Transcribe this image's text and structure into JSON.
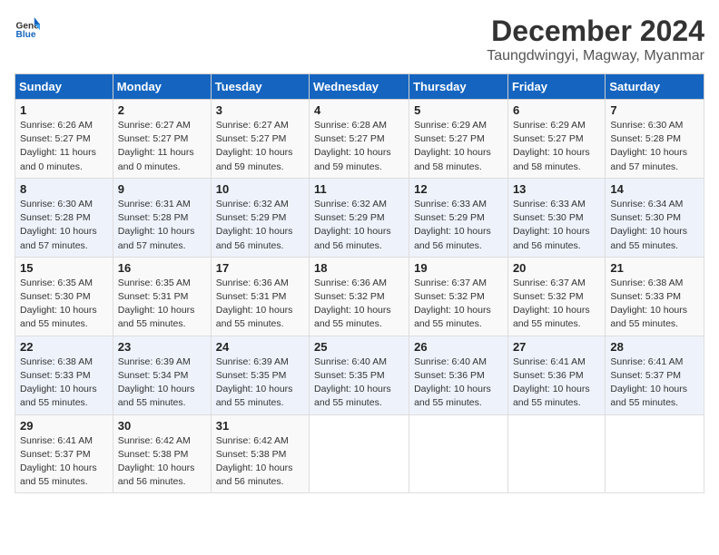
{
  "logo": {
    "general": "General",
    "blue": "Blue"
  },
  "title": "December 2024",
  "subtitle": "Taungdwingyi, Magway, Myanmar",
  "days_header": [
    "Sunday",
    "Monday",
    "Tuesday",
    "Wednesday",
    "Thursday",
    "Friday",
    "Saturday"
  ],
  "weeks": [
    [
      {
        "day": "1",
        "sunrise": "6:26 AM",
        "sunset": "5:27 PM",
        "daylight": "11 hours and 0 minutes."
      },
      {
        "day": "2",
        "sunrise": "6:27 AM",
        "sunset": "5:27 PM",
        "daylight": "11 hours and 0 minutes."
      },
      {
        "day": "3",
        "sunrise": "6:27 AM",
        "sunset": "5:27 PM",
        "daylight": "10 hours and 59 minutes."
      },
      {
        "day": "4",
        "sunrise": "6:28 AM",
        "sunset": "5:27 PM",
        "daylight": "10 hours and 59 minutes."
      },
      {
        "day": "5",
        "sunrise": "6:29 AM",
        "sunset": "5:27 PM",
        "daylight": "10 hours and 58 minutes."
      },
      {
        "day": "6",
        "sunrise": "6:29 AM",
        "sunset": "5:27 PM",
        "daylight": "10 hours and 58 minutes."
      },
      {
        "day": "7",
        "sunrise": "6:30 AM",
        "sunset": "5:28 PM",
        "daylight": "10 hours and 57 minutes."
      }
    ],
    [
      {
        "day": "8",
        "sunrise": "6:30 AM",
        "sunset": "5:28 PM",
        "daylight": "10 hours and 57 minutes."
      },
      {
        "day": "9",
        "sunrise": "6:31 AM",
        "sunset": "5:28 PM",
        "daylight": "10 hours and 57 minutes."
      },
      {
        "day": "10",
        "sunrise": "6:32 AM",
        "sunset": "5:29 PM",
        "daylight": "10 hours and 56 minutes."
      },
      {
        "day": "11",
        "sunrise": "6:32 AM",
        "sunset": "5:29 PM",
        "daylight": "10 hours and 56 minutes."
      },
      {
        "day": "12",
        "sunrise": "6:33 AM",
        "sunset": "5:29 PM",
        "daylight": "10 hours and 56 minutes."
      },
      {
        "day": "13",
        "sunrise": "6:33 AM",
        "sunset": "5:30 PM",
        "daylight": "10 hours and 56 minutes."
      },
      {
        "day": "14",
        "sunrise": "6:34 AM",
        "sunset": "5:30 PM",
        "daylight": "10 hours and 55 minutes."
      }
    ],
    [
      {
        "day": "15",
        "sunrise": "6:35 AM",
        "sunset": "5:30 PM",
        "daylight": "10 hours and 55 minutes."
      },
      {
        "day": "16",
        "sunrise": "6:35 AM",
        "sunset": "5:31 PM",
        "daylight": "10 hours and 55 minutes."
      },
      {
        "day": "17",
        "sunrise": "6:36 AM",
        "sunset": "5:31 PM",
        "daylight": "10 hours and 55 minutes."
      },
      {
        "day": "18",
        "sunrise": "6:36 AM",
        "sunset": "5:32 PM",
        "daylight": "10 hours and 55 minutes."
      },
      {
        "day": "19",
        "sunrise": "6:37 AM",
        "sunset": "5:32 PM",
        "daylight": "10 hours and 55 minutes."
      },
      {
        "day": "20",
        "sunrise": "6:37 AM",
        "sunset": "5:32 PM",
        "daylight": "10 hours and 55 minutes."
      },
      {
        "day": "21",
        "sunrise": "6:38 AM",
        "sunset": "5:33 PM",
        "daylight": "10 hours and 55 minutes."
      }
    ],
    [
      {
        "day": "22",
        "sunrise": "6:38 AM",
        "sunset": "5:33 PM",
        "daylight": "10 hours and 55 minutes."
      },
      {
        "day": "23",
        "sunrise": "6:39 AM",
        "sunset": "5:34 PM",
        "daylight": "10 hours and 55 minutes."
      },
      {
        "day": "24",
        "sunrise": "6:39 AM",
        "sunset": "5:35 PM",
        "daylight": "10 hours and 55 minutes."
      },
      {
        "day": "25",
        "sunrise": "6:40 AM",
        "sunset": "5:35 PM",
        "daylight": "10 hours and 55 minutes."
      },
      {
        "day": "26",
        "sunrise": "6:40 AM",
        "sunset": "5:36 PM",
        "daylight": "10 hours and 55 minutes."
      },
      {
        "day": "27",
        "sunrise": "6:41 AM",
        "sunset": "5:36 PM",
        "daylight": "10 hours and 55 minutes."
      },
      {
        "day": "28",
        "sunrise": "6:41 AM",
        "sunset": "5:37 PM",
        "daylight": "10 hours and 55 minutes."
      }
    ],
    [
      {
        "day": "29",
        "sunrise": "6:41 AM",
        "sunset": "5:37 PM",
        "daylight": "10 hours and 55 minutes."
      },
      {
        "day": "30",
        "sunrise": "6:42 AM",
        "sunset": "5:38 PM",
        "daylight": "10 hours and 56 minutes."
      },
      {
        "day": "31",
        "sunrise": "6:42 AM",
        "sunset": "5:38 PM",
        "daylight": "10 hours and 56 minutes."
      },
      null,
      null,
      null,
      null
    ]
  ]
}
